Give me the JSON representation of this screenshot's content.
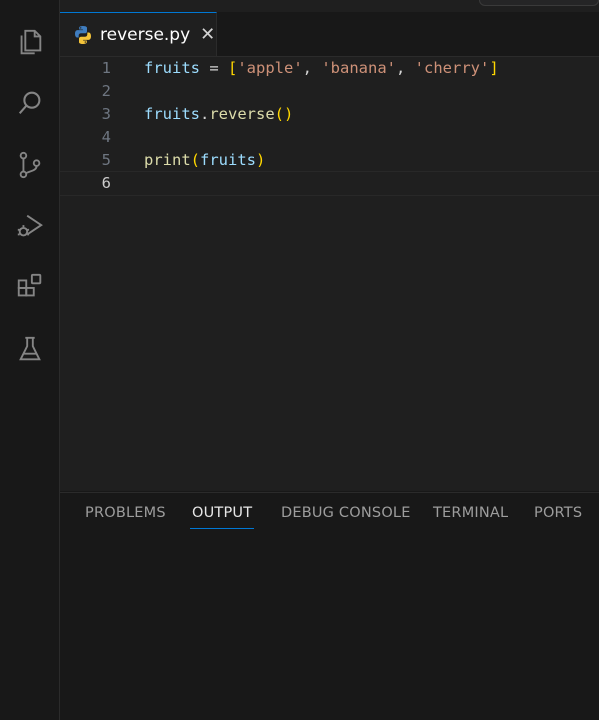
{
  "activity_bar": {
    "items": [
      {
        "name": "explorer-icon"
      },
      {
        "name": "search-icon"
      },
      {
        "name": "source-control-icon"
      },
      {
        "name": "run-debug-icon"
      },
      {
        "name": "extensions-icon"
      },
      {
        "name": "testing-icon"
      }
    ]
  },
  "tab": {
    "label": "reverse.py",
    "close": "✕",
    "icon": "python-icon"
  },
  "editor": {
    "line_numbers": [
      "1",
      "2",
      "3",
      "4",
      "5",
      "6"
    ],
    "current_line": "6",
    "code": {
      "l1": {
        "var": "fruits",
        "eq": " = ",
        "open": "[",
        "s1": "'apple'",
        "c1": ", ",
        "s2": "'banana'",
        "c2": ", ",
        "s3": "'cherry'",
        "close": "]"
      },
      "l3": {
        "obj": "fruits",
        "dot": ".",
        "method": "reverse",
        "parens": "()"
      },
      "l5": {
        "fn": "print",
        "open": "(",
        "arg": "fruits",
        "close": ")"
      }
    }
  },
  "panel": {
    "tabs": [
      "PROBLEMS",
      "OUTPUT",
      "DEBUG CONSOLE",
      "TERMINAL",
      "PORTS"
    ],
    "active_tab": "OUTPUT"
  },
  "colors": {
    "accent": "#0078d4",
    "background": "#181818",
    "editor_background": "#1f1f1f"
  }
}
